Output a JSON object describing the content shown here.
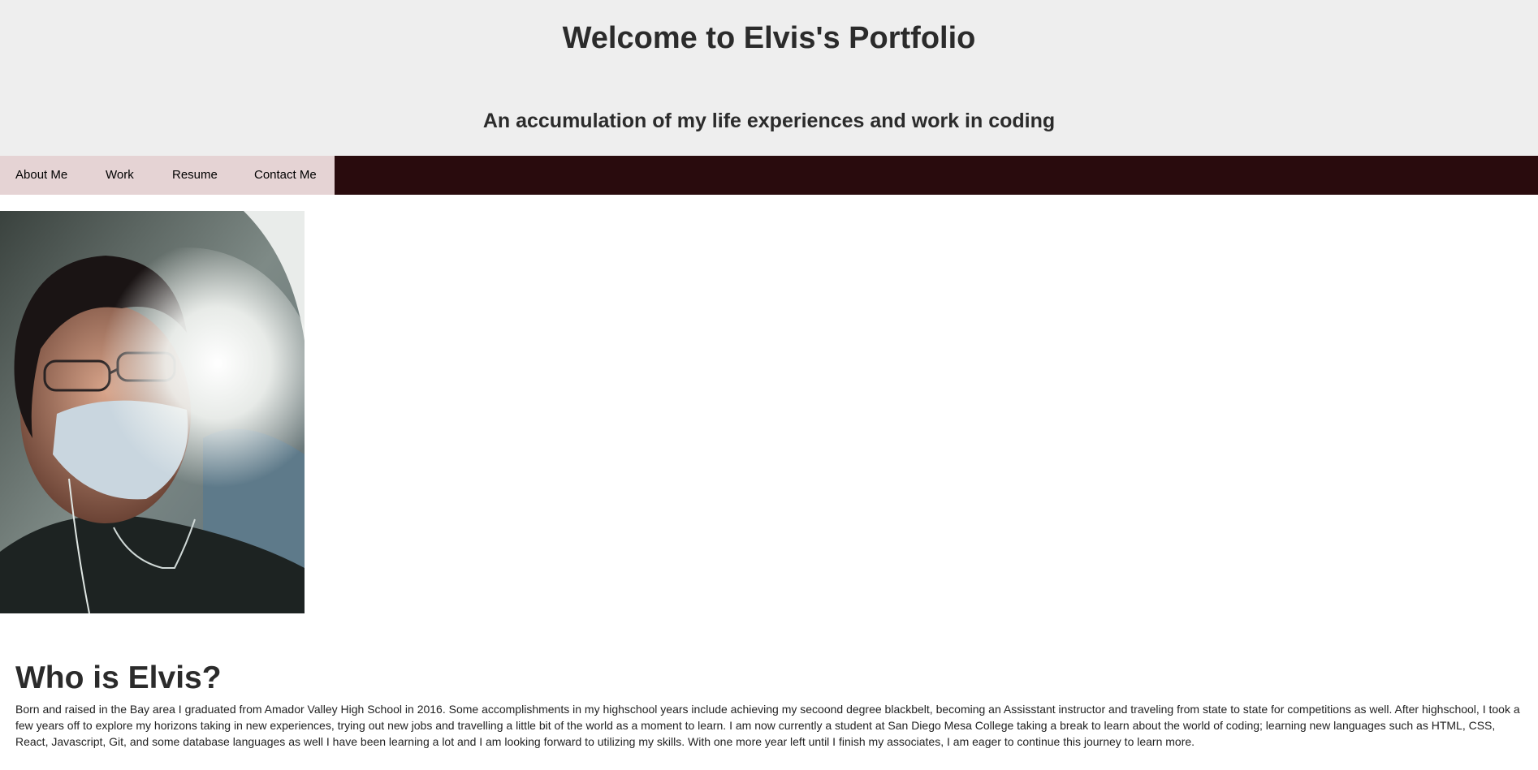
{
  "header": {
    "title": "Welcome to Elvis's Portfolio",
    "subtitle": "An accumulation of my life experiences and work in coding"
  },
  "nav": {
    "items": [
      {
        "label": "About Me"
      },
      {
        "label": "Work"
      },
      {
        "label": "Resume"
      },
      {
        "label": "Contact Me"
      }
    ]
  },
  "about": {
    "heading": "Who is Elvis?",
    "body": "Born and raised in the Bay area I graduated from Amador Valley High School in 2016. Some accomplishments in my highschool years include achieving my secoond degree blackbelt, becoming an Assisstant instructor and traveling from state to state for competitions as well. After highschool, I took a few years off to explore my horizons taking in new experiences, trying out new jobs and travelling a little bit of the world as a moment to learn. I am now currently a student at San Diego Mesa College taking a break to learn about the world of coding; learning new languages such as HTML, CSS, React, Javascript, Git, and some database languages as well I have been learning a lot and I am looking forward to utilizing my skills. With one more year left until I finish my associates, I am eager to continue this journey to learn more."
  },
  "colors": {
    "header_bg": "#eeeeee",
    "nav_bg": "#290b0d",
    "nav_items_bg": "#e5d3d4"
  }
}
